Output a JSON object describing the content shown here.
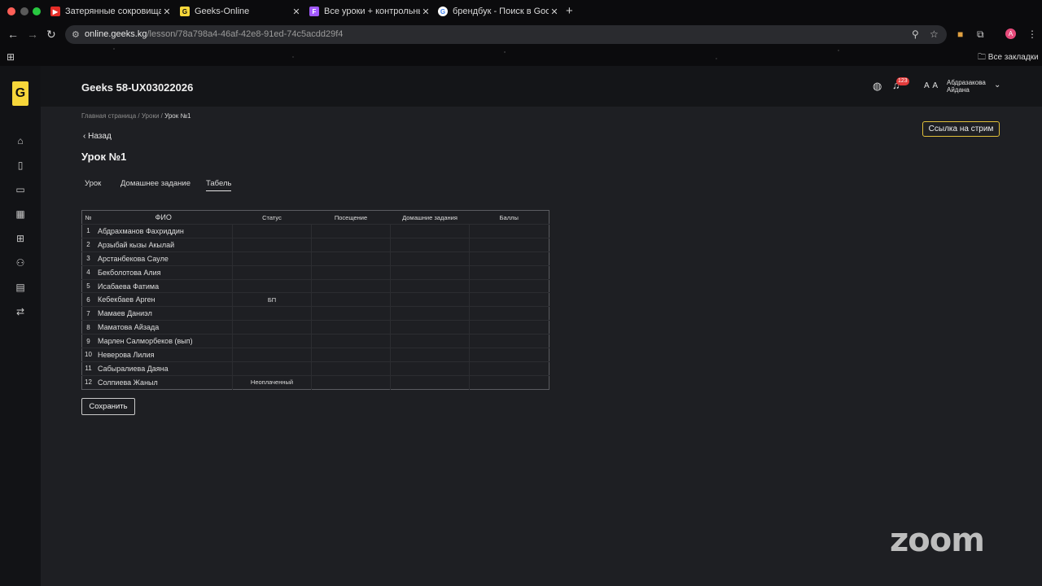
{
  "browser": {
    "tabs": [
      {
        "title": "Затерянные сокровища Erri",
        "favicon": "youtube-icon",
        "color": "#e52d27",
        "glyph": "▶"
      },
      {
        "title": "Geeks-Online",
        "favicon": "geeks-icon",
        "color": "#f6d63a",
        "glyph": "G"
      },
      {
        "title": "Все уроки + контрольные - ",
        "favicon": "figma-icon",
        "color": "#a259ff",
        "glyph": "F"
      },
      {
        "title": "брендбук - Поиск в Google",
        "favicon": "google-icon",
        "color": "#ffffff",
        "glyph": "G"
      }
    ],
    "url_host": "online.geeks.kg",
    "url_path": "/lesson/78a798a4-46af-42e8-91ed-74c5acdd29f4",
    "profile_initial": "A",
    "bookmarks_label": "Все закладки"
  },
  "header": {
    "group_title": "Geeks 58-UX03022026",
    "notification_count": "123",
    "avatar_initials": "A A",
    "user_name": "Абдразакова Айдана"
  },
  "sidebar": {
    "logo": "G",
    "items": [
      "home-icon",
      "book-icon",
      "open-book-icon",
      "calendar-icon",
      "table-icon",
      "users-icon",
      "document-icon",
      "swap-icon"
    ]
  },
  "main": {
    "breadcrumb": {
      "home": "Главная страница",
      "lessons": "Уроки",
      "current": "Урок №1",
      "sep": " / "
    },
    "back_label": "Назад",
    "page_title": "Урок №1",
    "stream_button": "Ссылка на стрим",
    "tabs": [
      "Урок",
      "Домашнее задание",
      "Табель"
    ],
    "active_tab": "Табель",
    "save_button": "Сохранить"
  },
  "table": {
    "headers": [
      "№",
      "ФИО",
      "Статус",
      "Посещение",
      "Домашние задания",
      "Баллы"
    ],
    "rows": [
      {
        "n": "1",
        "name": "Абдрахманов Фахриддин",
        "status": ""
      },
      {
        "n": "2",
        "name": "Арзыбай кызы Акылай",
        "status": ""
      },
      {
        "n": "3",
        "name": "Арстанбекова Сауле",
        "status": ""
      },
      {
        "n": "4",
        "name": "Бекболотова Алия",
        "status": ""
      },
      {
        "n": "5",
        "name": "Исабаева Фатима",
        "status": ""
      },
      {
        "n": "6",
        "name": "Кебекбаев Арген",
        "status": "БП"
      },
      {
        "n": "7",
        "name": "Мамаев Даниэл",
        "status": ""
      },
      {
        "n": "8",
        "name": "Маматова Айзада",
        "status": ""
      },
      {
        "n": "9",
        "name": "Марлен Салморбеков (вып)",
        "status": ""
      },
      {
        "n": "10",
        "name": "Неверова Лилия",
        "status": ""
      },
      {
        "n": "11",
        "name": "Сабыралиева Даяна",
        "status": ""
      },
      {
        "n": "12",
        "name": "Солпиева Жаныл",
        "status": "Неоплаченный"
      }
    ]
  },
  "overlay": {
    "zoom_logo": "zoom"
  },
  "colors": {
    "accent": "#f6d63a",
    "stream_border": "#e0bf3a",
    "badge": "#e23b3b"
  }
}
